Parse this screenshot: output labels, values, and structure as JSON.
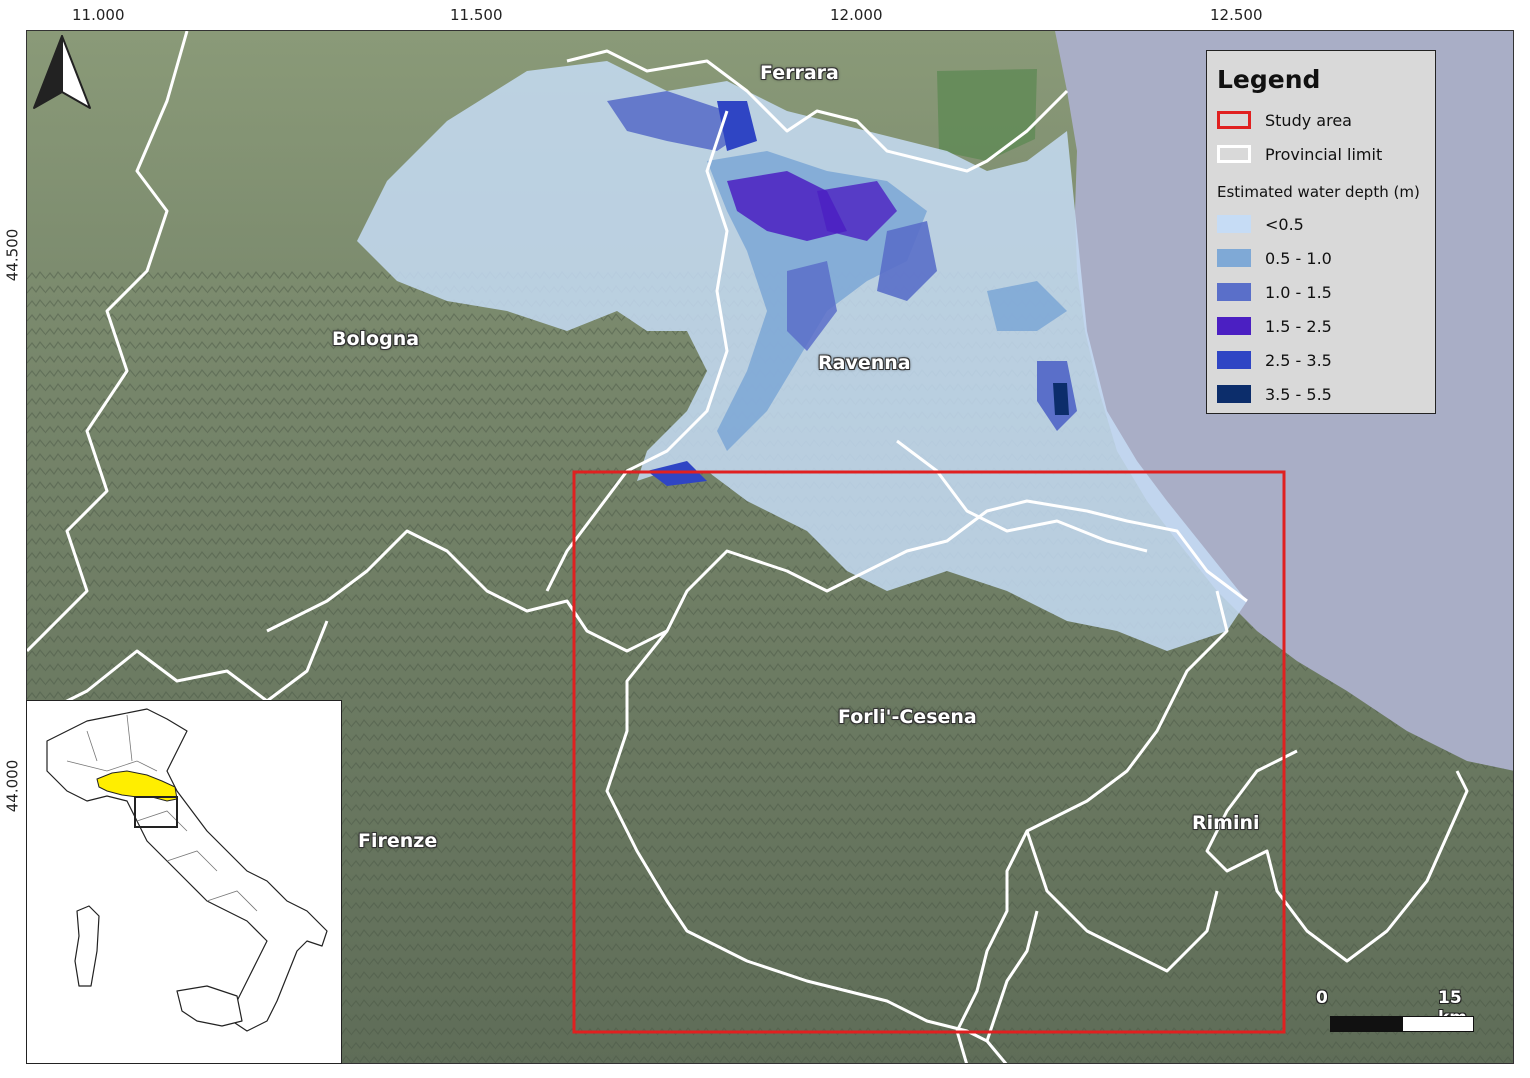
{
  "coordinates": {
    "top_longitudes": [
      "11.000",
      "11.500",
      "12.000",
      "12.500"
    ],
    "left_latitudes": [
      "44.500",
      "44.000"
    ]
  },
  "cities": {
    "ferrara": "Ferrara",
    "bologna": "Bologna",
    "ravenna": "Ravenna",
    "forli_cesena": "Forli'-Cesena",
    "firenze": "Firenze",
    "rimini": "Rimini"
  },
  "legend": {
    "title": "Legend",
    "study_area": "Study area",
    "provincial_limit": "Provincial limit",
    "depth_title": "Estimated water depth (m)",
    "depth_classes": [
      {
        "label": "<0.5",
        "color": "#c6dcf5"
      },
      {
        "label": "0.5 - 1.0",
        "color": "#7fa9d6"
      },
      {
        "label": "1.0 - 1.5",
        "color": "#5a6fc9"
      },
      {
        "label": " 1.5 - 2.5",
        "color": "#4b1fc2"
      },
      {
        "label": "2.5 - 3.5",
        "color": "#2f45c4"
      },
      {
        "label": "3.5 - 5.5",
        "color": "#0c2d6b"
      }
    ]
  },
  "scale_bar": {
    "start": "0",
    "end": "15 km"
  },
  "colors": {
    "sea": "#a9aec6",
    "land": "#6f7d64",
    "study_area_outline": "#e02020",
    "provincial_limit": "#ffffff",
    "inset_highlight": "#ffee00"
  }
}
